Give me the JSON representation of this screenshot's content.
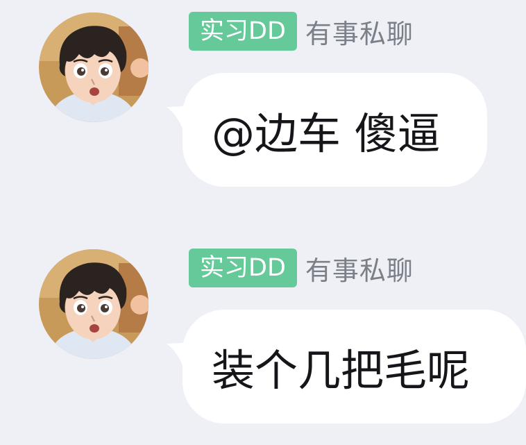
{
  "chat": {
    "messages": [
      {
        "badge": "实习DD",
        "sender": "有事私聊",
        "text": "@边车 傻逼"
      },
      {
        "badge": "实习DD",
        "sender": "有事私聊",
        "text": "装个几把毛呢"
      }
    ]
  },
  "colors": {
    "background": "#eff0f6",
    "badge": "#66c99a",
    "sender_text": "#7b7f88",
    "bubble": "#ffffff",
    "message_text": "#16161a"
  }
}
